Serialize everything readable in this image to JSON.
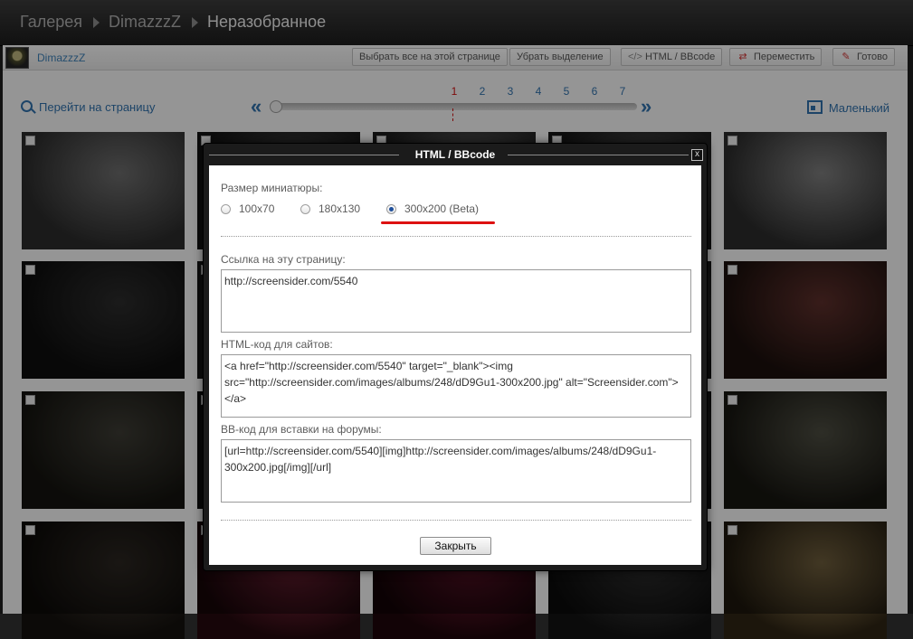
{
  "header": {
    "breadcrumb": [
      "Галерея",
      "DimazzzZ",
      "Неразобранное"
    ]
  },
  "toolbar": {
    "username": "DimazzzZ",
    "select_all_label": "Выбрать все на этой странице",
    "deselect_label": "Убрать выделение",
    "html_bbcode_label": "HTML / BBcode",
    "move_label": "Переместить",
    "done_label": "Готово"
  },
  "gallery": {
    "goto_page_label": "Перейти на страницу",
    "size_label": "Маленький",
    "pages": [
      "1",
      "2",
      "3",
      "4",
      "5",
      "6",
      "7"
    ],
    "current_page": "1"
  },
  "dialog": {
    "title": "HTML / BBcode",
    "close_glyph": "x",
    "thumb_size_label": "Размер миниатюры:",
    "sizes": [
      "100x70",
      "180x130",
      "300x200 (Beta)"
    ],
    "selected_size": "300x200 (Beta)",
    "page_link_label": "Ссылка на эту страницу:",
    "page_link_value": "http://screensider.com/5540",
    "html_code_label": "HTML-код для сайтов:",
    "html_code_value": "<a href=\"http://screensider.com/5540\" target=\"_blank\"><img src=\"http://screensider.com/images/albums/248/dD9Gu1-300x200.jpg\" alt=\"Screensider.com\"></a>",
    "bb_code_label": "BB-код для вставки на форумы:",
    "bb_code_value": "[url=http://screensider.com/5540][img]http://screensider.com/images/albums/248/dD9Gu1-300x200.jpg[/img][/url]",
    "close_button_label": "Закрыть"
  },
  "colors": {
    "link": "#2f6fa8",
    "accent_red": "#dd1111"
  }
}
